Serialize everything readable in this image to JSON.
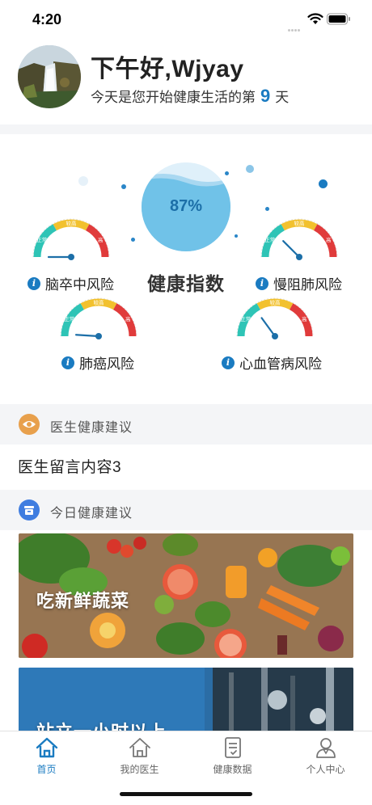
{
  "status_bar": {
    "time": "4:20"
  },
  "profile": {
    "greeting": "下午好,Wjyay",
    "day_prefix": "今天是您开始健康生活的第",
    "day_count": "9",
    "day_suffix": "天"
  },
  "health": {
    "title": "健康指数",
    "score_percent": "87%",
    "score_value": 87,
    "zone_labels": [
      "正常",
      "较高",
      "高"
    ],
    "risks": [
      {
        "label": "脑卒中风险",
        "level": 0.0
      },
      {
        "label": "慢阻肺风险",
        "level": 0.25
      },
      {
        "label": "肺癌风险",
        "level": 0.02
      },
      {
        "label": "心血管病风险",
        "level": 0.3
      }
    ]
  },
  "doctor_advice": {
    "section_title": "医生健康建议",
    "message": "医生留言内容3",
    "icon": "eye-icon"
  },
  "daily_advice": {
    "section_title": "今日健康建议",
    "icon": "archive-icon",
    "cards": [
      {
        "title": "吃新鲜蔬菜"
      },
      {
        "title": "站立一小时以上"
      }
    ]
  },
  "tab_bar": {
    "tabs": [
      {
        "label": "首页",
        "icon": "home-icon",
        "active": true
      },
      {
        "label": "我的医生",
        "icon": "home-outline-icon",
        "active": false
      },
      {
        "label": "健康数据",
        "icon": "clipboard-icon",
        "active": false
      },
      {
        "label": "个人中心",
        "icon": "user-icon",
        "active": false
      }
    ]
  },
  "colors": {
    "accent": "#1a7bc1",
    "gauge_green": "#2ec4b6",
    "gauge_yellow": "#f2c12e",
    "gauge_red": "#e03b3b",
    "doctor_icon": "#e8a04c",
    "daily_icon": "#3f7de0"
  }
}
